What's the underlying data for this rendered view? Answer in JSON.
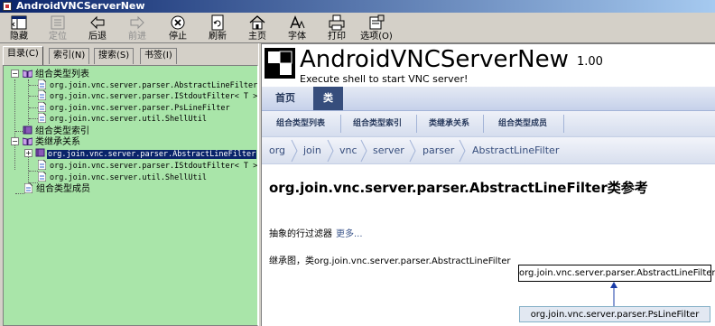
{
  "window": {
    "title": "AndroidVNCServerNew"
  },
  "toolbar": {
    "buttons": [
      {
        "label": "隐藏",
        "icon": "hide-icon",
        "enabled": true
      },
      {
        "label": "定位",
        "icon": "locate-icon",
        "enabled": false
      },
      {
        "label": "后退",
        "icon": "back-arrow-icon",
        "enabled": true
      },
      {
        "label": "前进",
        "icon": "forward-arrow-icon",
        "enabled": false
      },
      {
        "label": "停止",
        "icon": "stop-icon",
        "enabled": true
      },
      {
        "label": "刷新",
        "icon": "refresh-icon",
        "enabled": true
      },
      {
        "label": "主页",
        "icon": "home-icon",
        "enabled": true
      },
      {
        "label": "字体",
        "icon": "font-icon",
        "enabled": true
      },
      {
        "label": "打印",
        "icon": "print-icon",
        "enabled": true
      },
      {
        "label": "选项(O)",
        "icon": "options-icon",
        "enabled": true
      }
    ]
  },
  "tabs": [
    {
      "label": "目录(C)",
      "active": true
    },
    {
      "label": "索引(N)",
      "active": false
    },
    {
      "label": "搜索(S)",
      "active": false
    },
    {
      "label": "书签(I)",
      "active": false
    }
  ],
  "tree": {
    "nodes": [
      {
        "label": "组合类型列表",
        "type": "book-open"
      },
      {
        "label": "org.join.vnc.server.parser.AbstractLineFilter",
        "type": "page"
      },
      {
        "label": "org.join.vnc.server.parser.IStdoutFilter< T >",
        "type": "page"
      },
      {
        "label": "org.join.vnc.server.parser.PsLineFilter",
        "type": "page"
      },
      {
        "label": "org.join.vnc.server.util.ShellUtil",
        "type": "page"
      },
      {
        "label": "组合类型索引",
        "type": "book-closed"
      },
      {
        "label": "类继承关系",
        "type": "book-open"
      },
      {
        "label": "org.join.vnc.server.parser.AbstractLineFilter",
        "type": "book-closed",
        "selected": true
      },
      {
        "label": "org.join.vnc.server.parser.IStdoutFilter< T >",
        "type": "page"
      },
      {
        "label": "org.join.vnc.server.util.ShellUtil",
        "type": "page"
      },
      {
        "label": "组合类型成员",
        "type": "page"
      }
    ]
  },
  "content": {
    "project_name": "AndroidVNCServerNew",
    "project_version": "1.00",
    "project_brief": "Execute shell to start VNC server!",
    "nav_main": [
      {
        "label": "首页",
        "current": false
      },
      {
        "label": "类",
        "current": true
      }
    ],
    "nav_sub": [
      {
        "label": "组合类型列表"
      },
      {
        "label": "组合类型索引"
      },
      {
        "label": "类继承关系"
      },
      {
        "label": "组合类型成员"
      }
    ],
    "breadcrumb": [
      "org",
      "join",
      "vnc",
      "server",
      "parser",
      "AbstractLineFilter"
    ],
    "title": "org.join.vnc.server.parser.AbstractLineFilter类参考",
    "brief_text": "抽象的行过滤器",
    "more_link": "更多...",
    "inheritance_title": "继承图，类org.join.vnc.server.parser.AbstractLineFilter",
    "diagram": {
      "base": "org.join.vnc.server.parser.AbstractLineFilter",
      "derived": "org.join.vnc.server.parser.PsLineFilter"
    }
  },
  "colors": {
    "tree_bg": "#a9e5a9",
    "nav_current": "#364d7c",
    "link": "#3d578c"
  }
}
